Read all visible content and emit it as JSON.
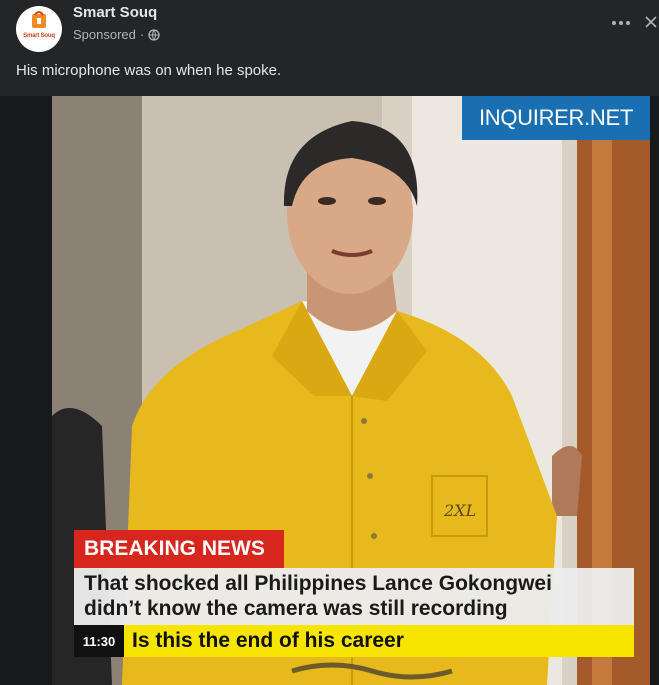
{
  "post": {
    "page_name": "Smart Souq",
    "avatar_text": "Smart Souq",
    "sponsored": "Sponsored",
    "separator": "·",
    "more_icon": "more-dots-icon",
    "close_icon": "close-icon",
    "caption": "His microphone was on when he spoke."
  },
  "image": {
    "badge": "INQUIRER.NET",
    "breaking_tag": "BREAKING NEWS",
    "headline_line1": "That shocked all Philippines Lance Gokongwei",
    "headline_line2": "didn’t know the camera was still recording",
    "ticker_time": "11:30",
    "ticker_text": "Is this the end of his career",
    "shirt_mark": "2XL",
    "colors": {
      "badge": "#1a6fb3",
      "breaking": "#d7261e",
      "ticker": "#f7e500",
      "jumpsuit": "#e8b91c"
    }
  }
}
